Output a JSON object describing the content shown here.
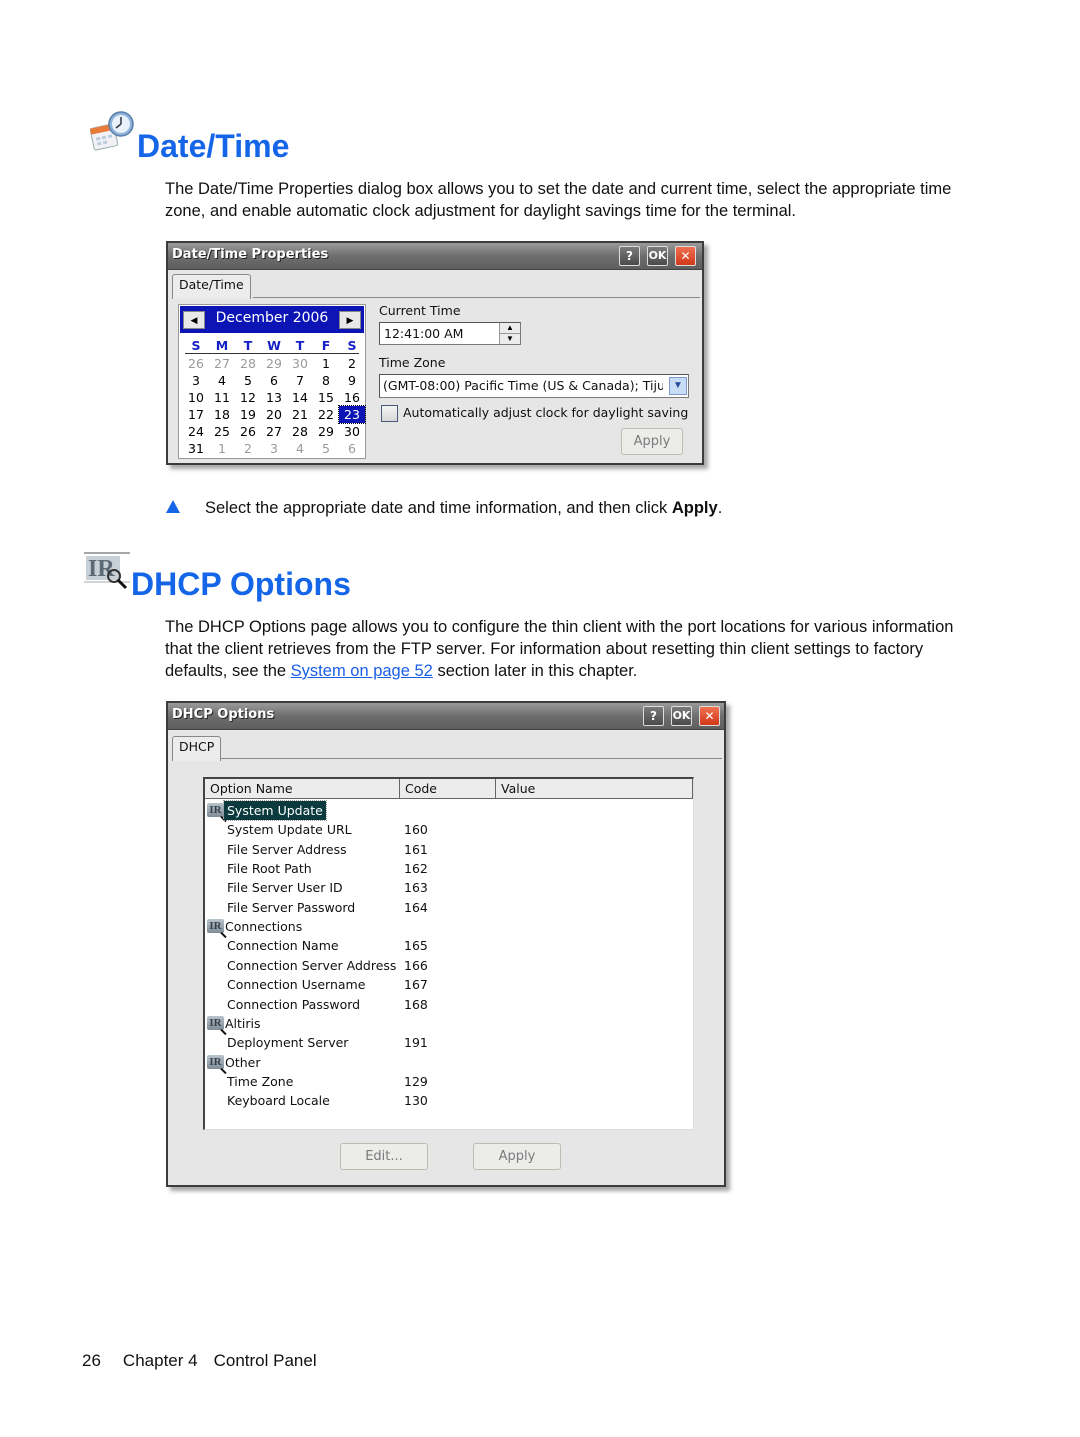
{
  "sections": {
    "datetime": {
      "heading": "Date/Time",
      "icon": "calendar-clock-icon",
      "paragraph": "The Date/Time Properties dialog box allows you to set the date and current time, select the appropriate time zone, and enable automatic clock adjustment for daylight savings time for the terminal.",
      "step_icon": "triangle-bullet-icon",
      "step_text_pre": "Select the appropriate date and time information, and then click ",
      "step_text_bold": "Apply",
      "step_text_post": "."
    },
    "dhcp": {
      "heading": "DHCP Options",
      "icon": "dhcp-magnifier-icon",
      "paragraph_pre": "The DHCP Options page allows you to configure the thin client with the port locations for various information that the client retrieves from the FTP server. For information about resetting thin client settings to factory defaults, see the ",
      "link_text": "System on page 52",
      "paragraph_post": " section later in this chapter."
    }
  },
  "datetime_dialog": {
    "title": "Date/Time Properties",
    "help_label": "?",
    "ok_label": "OK",
    "close_label": "✕",
    "tab_label": "Date/Time",
    "calendar": {
      "month_year": "December 2006",
      "prev_label": "◀",
      "next_label": "▶",
      "weekdays": [
        "S",
        "M",
        "T",
        "W",
        "T",
        "F",
        "S"
      ],
      "weeks": [
        [
          "26",
          "27",
          "28",
          "29",
          "30",
          "1",
          "2"
        ],
        [
          "3",
          "4",
          "5",
          "6",
          "7",
          "8",
          "9"
        ],
        [
          "10",
          "11",
          "12",
          "13",
          "14",
          "15",
          "16"
        ],
        [
          "17",
          "18",
          "19",
          "20",
          "21",
          "22",
          "23"
        ],
        [
          "24",
          "25",
          "26",
          "27",
          "28",
          "29",
          "30"
        ],
        [
          "31",
          "1",
          "2",
          "3",
          "4",
          "5",
          "6"
        ]
      ],
      "selected_day": "23"
    },
    "current_time_label": "Current Time",
    "current_time_value": "12:41:00 AM",
    "time_zone_label": "Time Zone",
    "time_zone_value": "(GMT-08:00) Pacific Time (US & Canada); Tiju",
    "dst_checkbox_label": "Automatically adjust clock for daylight saving",
    "dst_checked": false,
    "apply_label": "Apply"
  },
  "dhcp_dialog": {
    "title": "DHCP Options",
    "help_label": "?",
    "ok_label": "OK",
    "close_label": "✕",
    "tab_label": "DHCP",
    "columns": [
      "Option Name",
      "Code",
      "Value"
    ],
    "rows": [
      {
        "type": "group",
        "name": "System Update",
        "code": "",
        "selected": true
      },
      {
        "type": "item",
        "name": "System Update URL",
        "code": "160"
      },
      {
        "type": "item",
        "name": "File Server Address",
        "code": "161"
      },
      {
        "type": "item",
        "name": "File Root Path",
        "code": "162"
      },
      {
        "type": "item",
        "name": "File Server User ID",
        "code": "163"
      },
      {
        "type": "item",
        "name": "File Server Password",
        "code": "164"
      },
      {
        "type": "group",
        "name": "Connections",
        "code": ""
      },
      {
        "type": "item",
        "name": "Connection Name",
        "code": "165"
      },
      {
        "type": "item",
        "name": "Connection Server Address",
        "code": "166"
      },
      {
        "type": "item",
        "name": "Connection Username",
        "code": "167"
      },
      {
        "type": "item",
        "name": "Connection Password",
        "code": "168"
      },
      {
        "type": "group",
        "name": "Altiris",
        "code": ""
      },
      {
        "type": "item",
        "name": "Deployment Server",
        "code": "191"
      },
      {
        "type": "group",
        "name": "Other",
        "code": ""
      },
      {
        "type": "item",
        "name": "Time Zone",
        "code": "129"
      },
      {
        "type": "item",
        "name": "Keyboard Locale",
        "code": "130"
      }
    ],
    "edit_label": "Edit...",
    "apply_label": "Apply"
  },
  "footer": {
    "page_number": "26",
    "chapter": "Chapter 4",
    "chapter_title": "Control Panel"
  },
  "colors": {
    "heading": "#1565e8",
    "link": "#1a5ee8",
    "calendar_header": "#0c14b6"
  }
}
